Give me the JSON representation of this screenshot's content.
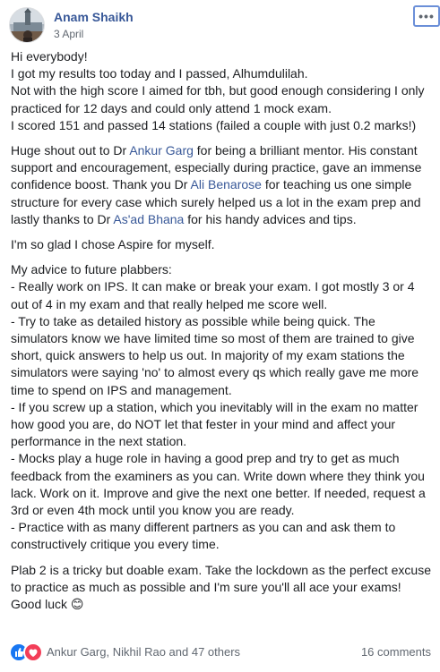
{
  "post": {
    "author": "Anam Shaikh",
    "date": "3 April",
    "more_label": "•••",
    "paragraphs": [
      [
        {
          "t": "Hi everybody!"
        },
        {
          "br": true
        },
        {
          "t": "I got my results too today and I passed, Alhumdulilah."
        },
        {
          "br": true
        },
        {
          "t": "Not with the high score I aimed for tbh, but good enough considering I only practiced for 12 days and could only attend 1 mock exam."
        },
        {
          "br": true
        },
        {
          "t": "I scored 151 and passed 14 stations (failed a couple with just 0.2 marks!)"
        }
      ],
      [
        {
          "t": "Huge shout out to Dr "
        },
        {
          "m": "Ankur Garg"
        },
        {
          "t": " for being a brilliant mentor. His constant support and encouragement, especially during practice, gave an immense confidence boost. Thank you Dr "
        },
        {
          "m": "Ali Benarose"
        },
        {
          "t": " for teaching us one simple structure for every case which surely helped us a lot in the exam prep and lastly thanks to Dr "
        },
        {
          "m": "As'ad Bhana"
        },
        {
          "t": " for his handy advices and tips."
        }
      ],
      [
        {
          "t": "I'm so glad I chose Aspire for myself."
        }
      ],
      [
        {
          "t": "My advice to future plabbers:"
        },
        {
          "br": true
        },
        {
          "t": "- Really work on IPS. It can make or break your exam. I got mostly 3 or 4 out of 4 in my exam and that really helped me score well."
        },
        {
          "br": true
        },
        {
          "t": "- Try to take as detailed history as possible while being quick. The simulators know we have limited time so most of them are trained to give short, quick answers to help us out. In majority of my exam stations the simulators were saying 'no' to almost every qs which really gave me more time to spend on IPS and management."
        },
        {
          "br": true
        },
        {
          "t": "- If you screw up a station, which you inevitably will in the exam no matter how good you are, do NOT let that fester in your mind and affect your performance in the next station."
        },
        {
          "br": true
        },
        {
          "t": "- Mocks play a huge role in having a good prep and try to get as much feedback from the examiners as you can. Write down where they think you lack. Work on it. Improve and give the next one better. If needed, request a 3rd or even 4th mock until you know you are ready."
        },
        {
          "br": true
        },
        {
          "t": "- Practice with as many different partners as you can and ask them to constructively critique you every time."
        }
      ],
      [
        {
          "t": "Plab 2 is a tricky but doable exam. Take the lockdown as the perfect excuse to practice as much as possible and I'm sure you'll all ace your exams!"
        },
        {
          "br": true
        },
        {
          "t": "Good luck 😊"
        }
      ]
    ]
  },
  "footer": {
    "reaction_names": "Ankur Garg, Nikhil Rao and 47 others",
    "comments": "16 comments",
    "reaction_icons": [
      "like-icon",
      "love-icon"
    ],
    "like_color": "#1877f2",
    "love_color": "#f33e58"
  }
}
